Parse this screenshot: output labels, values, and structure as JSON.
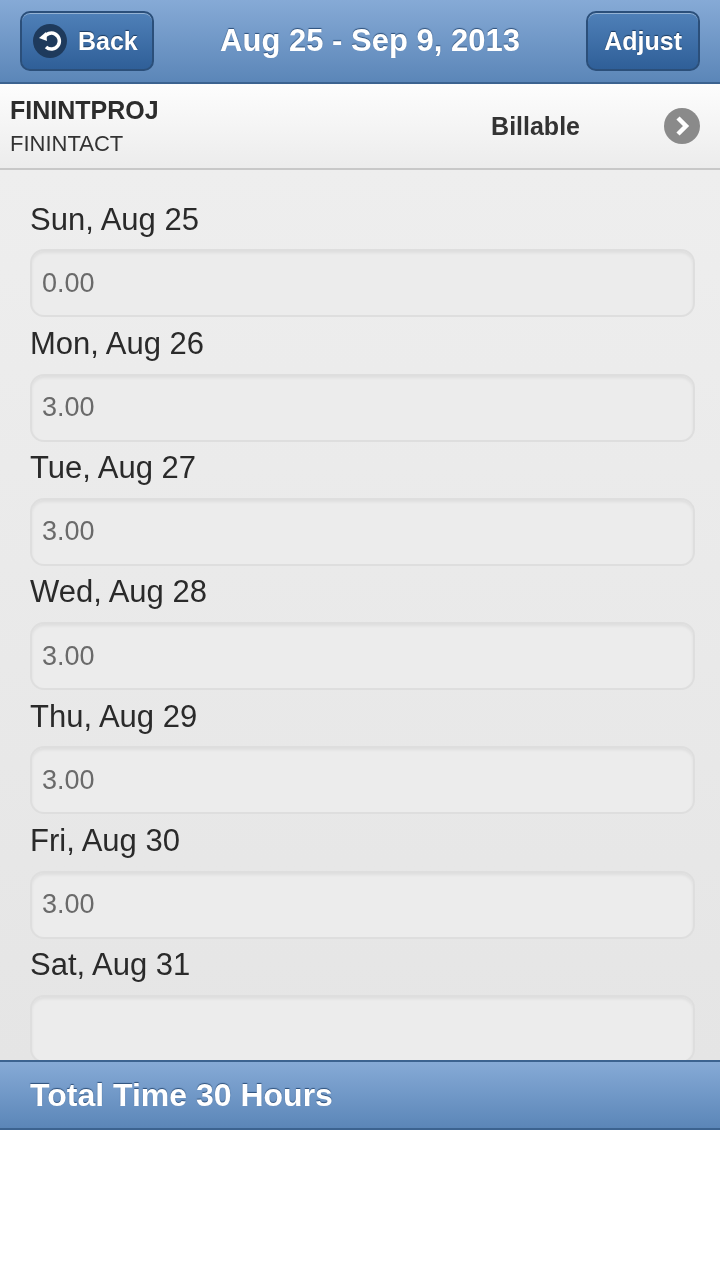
{
  "header": {
    "back_label": "Back",
    "title": "Aug 25 - Sep 9, 2013",
    "adjust_label": "Adjust"
  },
  "project": {
    "code": "FININTPROJ",
    "activity": "FININTACT",
    "billing": "Billable"
  },
  "days": [
    {
      "label": "Sun, Aug 25",
      "hours": "0.00"
    },
    {
      "label": "Mon, Aug 26",
      "hours": "3.00"
    },
    {
      "label": "Tue, Aug 27",
      "hours": "3.00"
    },
    {
      "label": "Wed, Aug 28",
      "hours": "3.00"
    },
    {
      "label": "Thu, Aug 29",
      "hours": "3.00"
    },
    {
      "label": "Fri, Aug 30",
      "hours": "3.00"
    },
    {
      "label": "Sat, Aug 31"
    }
  ],
  "footer": {
    "total": "Total Time 30 Hours"
  }
}
